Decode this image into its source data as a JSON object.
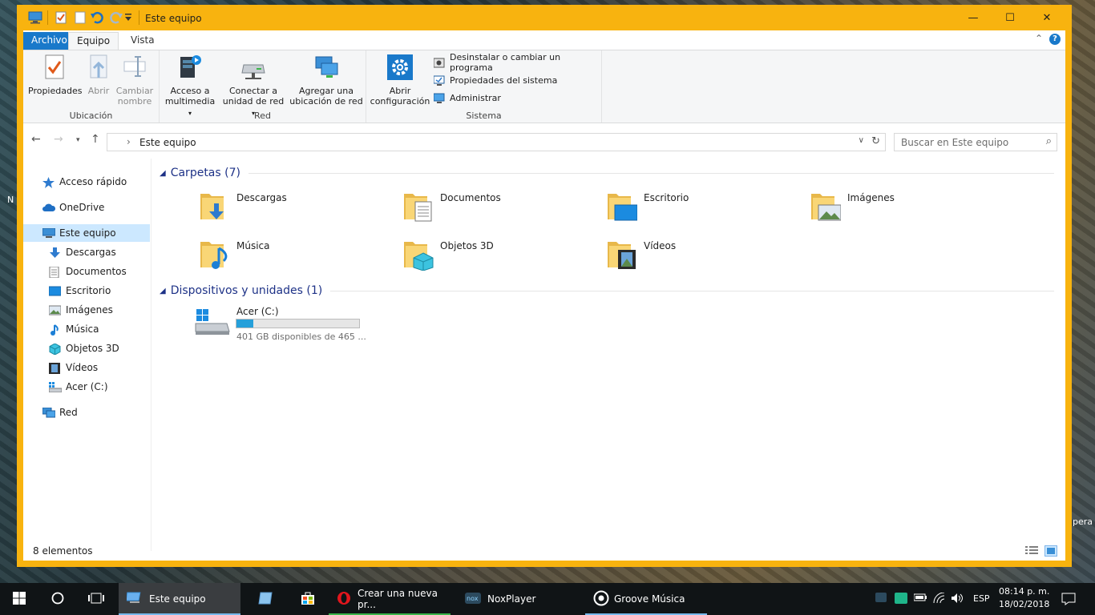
{
  "window": {
    "title": "Este equipo",
    "minimize": "—",
    "maximize": "☐",
    "close": "✕"
  },
  "ribbon": {
    "tabs": [
      "Archivo",
      "Equipo",
      "Vista"
    ],
    "groups": {
      "ubicacion": {
        "label": "Ubicación",
        "propiedades": "Propiedades",
        "abrir": "Abrir",
        "cambiar_nombre_1": "Cambiar",
        "cambiar_nombre_2": "nombre"
      },
      "red": {
        "label": "Red",
        "acceso_1": "Acceso a",
        "acceso_2": "multimedia",
        "conectar_1": "Conectar a",
        "conectar_2": "unidad de red",
        "agregar_1": "Agregar una",
        "agregar_2": "ubicación de red"
      },
      "sistema": {
        "label": "Sistema",
        "abrir_1": "Abrir",
        "abrir_2": "configuración",
        "desinstalar": "Desinstalar o cambiar un programa",
        "propiedades_sistema": "Propiedades del sistema",
        "administrar": "Administrar"
      }
    }
  },
  "address": {
    "path": "Este equipo",
    "search_placeholder": "Buscar en Este equipo"
  },
  "nav": {
    "items": [
      "Acceso rápido",
      "OneDrive",
      "Este equipo",
      "Descargas",
      "Documentos",
      "Escritorio",
      "Imágenes",
      "Música",
      "Objetos 3D",
      "Vídeos",
      "Acer (C:)",
      "Red"
    ]
  },
  "content": {
    "folders_header": "Carpetas (7)",
    "folders": [
      "Descargas",
      "Documentos",
      "Escritorio",
      "Imágenes",
      "Música",
      "Objetos 3D",
      "Vídeos"
    ],
    "devices_header": "Dispositivos y unidades (1)",
    "drive": {
      "name": "Acer (C:)",
      "free_text": "401 GB disponibles de 465 ...",
      "used_fraction": 0.138
    }
  },
  "status": {
    "count": "8 elementos"
  },
  "taskbar": {
    "apps": [
      "Este equipo",
      "Crear una nueva pr...",
      "NoxPlayer",
      "Groove Música"
    ],
    "lang": "ESP",
    "time": "08:14 p. m.",
    "date": "18/02/2018"
  },
  "desktop_edge_text": {
    "left_n": "N",
    "right_pera": "pera"
  },
  "colors": {
    "window_accent": "#f8b30f",
    "selection": "#cce8ff",
    "link_blue": "#1e3287",
    "drive_bar": "#26a0da"
  }
}
